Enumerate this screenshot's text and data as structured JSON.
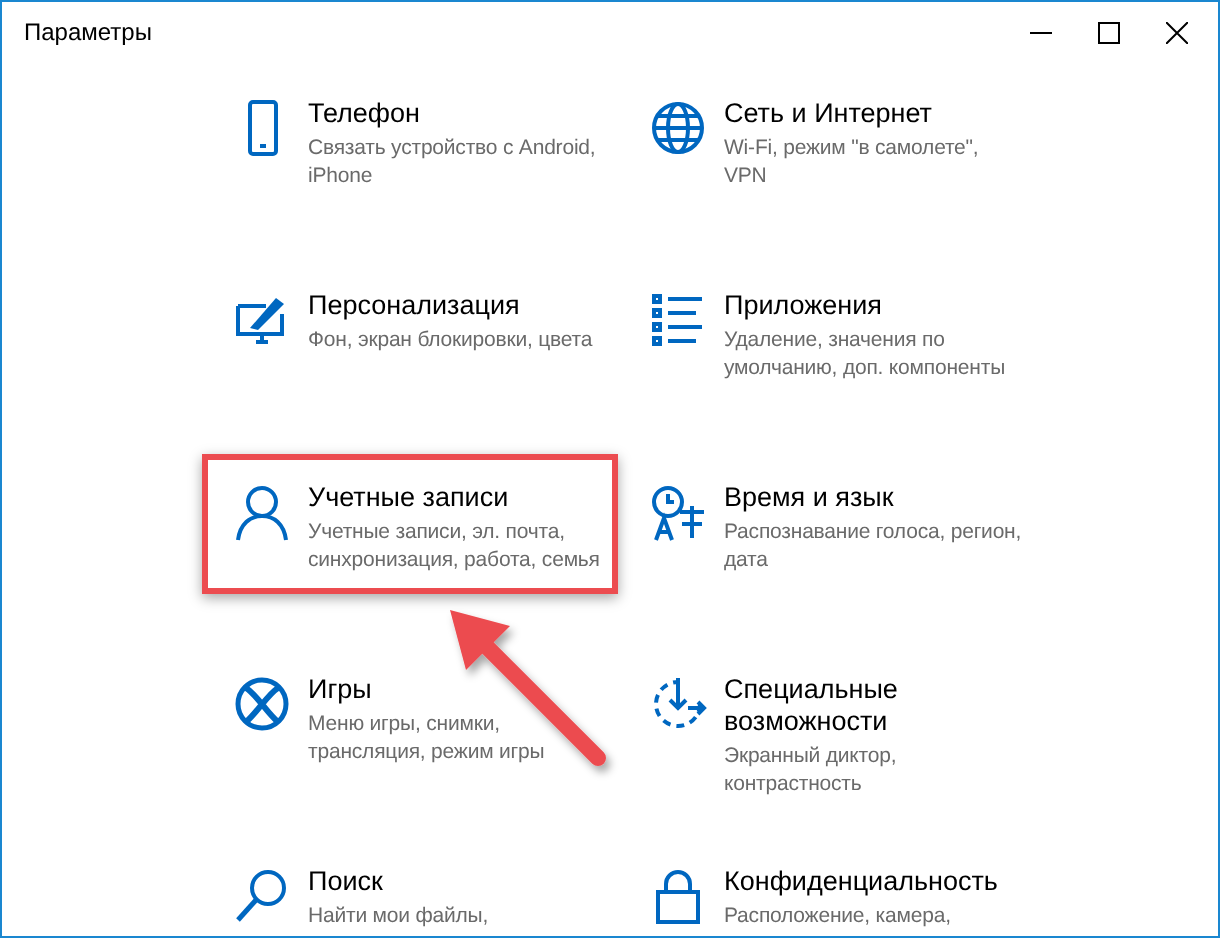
{
  "window": {
    "title": "Параметры"
  },
  "items": [
    {
      "title": "Телефон",
      "description": "Связать устройство с Android, iPhone",
      "highlighted": false
    },
    {
      "title": "Сеть и Интернет",
      "description": "Wi-Fi, режим \"в самолете\", VPN",
      "highlighted": false
    },
    {
      "title": "Персонализация",
      "description": "Фон, экран блокировки, цвета",
      "highlighted": false
    },
    {
      "title": "Приложения",
      "description": "Удаление, значения по умолчанию, доп. компоненты",
      "highlighted": false
    },
    {
      "title": "Учетные записи",
      "description": "Учетные записи, эл. почта, синхронизация, работа, семья",
      "highlighted": true
    },
    {
      "title": "Время и язык",
      "description": "Распознавание голоса, регион, дата",
      "highlighted": false
    },
    {
      "title": "Игры",
      "description": "Меню игры, снимки, трансляция, режим игры",
      "highlighted": false
    },
    {
      "title": "Специальные возможности",
      "description": "Экранный диктор, контрастность",
      "highlighted": false
    },
    {
      "title": "Поиск",
      "description": "Найти мои файлы,",
      "highlighted": false
    },
    {
      "title": "Конфиденциальность",
      "description": "Расположение, камера,",
      "highlighted": false
    }
  ]
}
